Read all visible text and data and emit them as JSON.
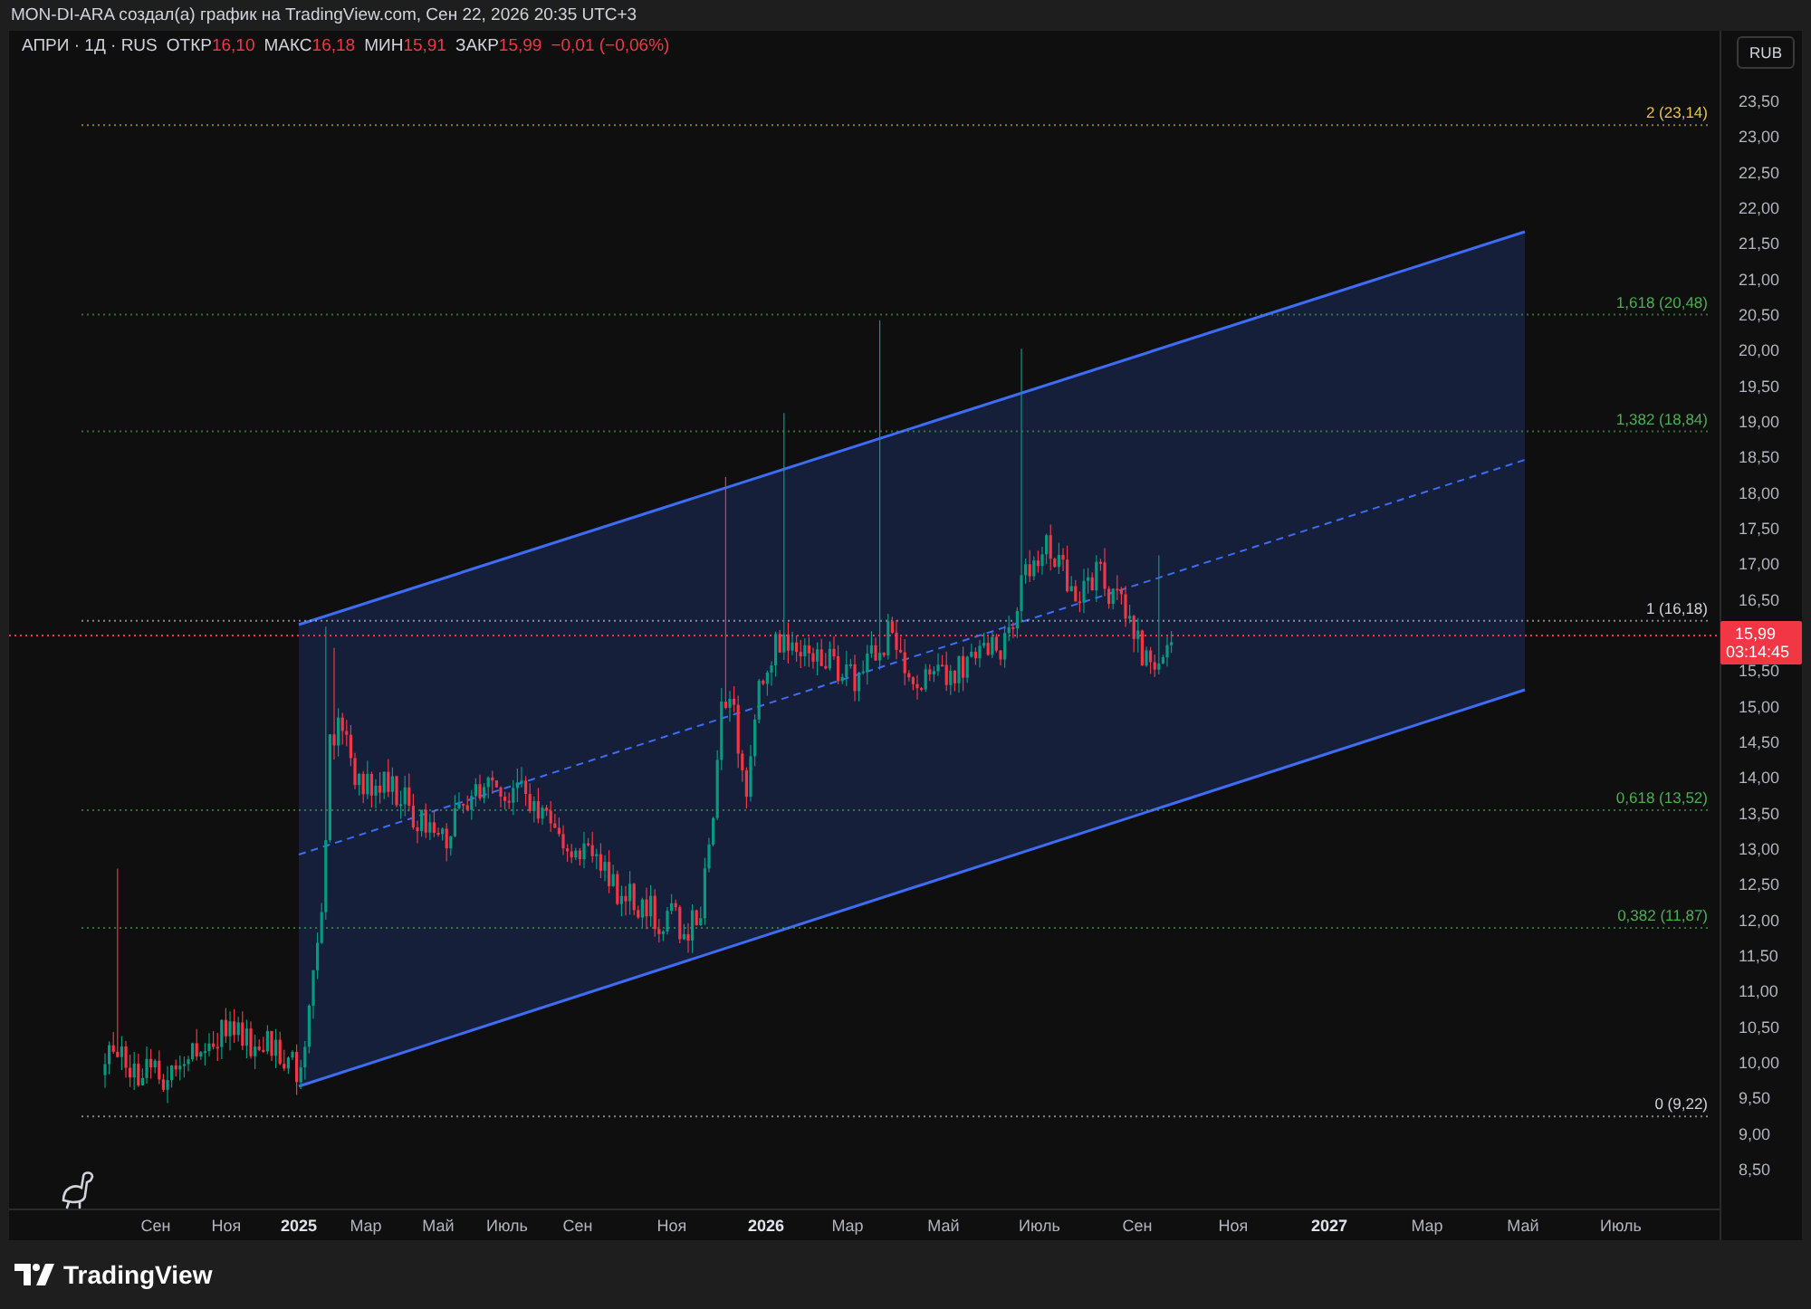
{
  "header": {
    "text": "MON-DI-ARA создал(а) график на TradingView.com, Сен 22, 2026 20:35 UTC+3"
  },
  "legend": {
    "symbol": "АПРИ · 1Д · RUS",
    "values": [
      {
        "label": "ОТКР",
        "value": "16,10"
      },
      {
        "label": "МАКС",
        "value": "16,18"
      },
      {
        "label": "МИН",
        "value": "15,91"
      },
      {
        "label": "ЗАКР",
        "value": "15,99"
      }
    ],
    "change": "−0,01 (−0,06%)"
  },
  "currency_button": {
    "label": "RUB"
  },
  "price_axis": {
    "ticks": [
      "23,50",
      "23,00",
      "22,50",
      "22,00",
      "21,50",
      "21,00",
      "20,50",
      "20,00",
      "19,50",
      "19,00",
      "18,50",
      "18,00",
      "17,50",
      "17,00",
      "16,50",
      "15,50",
      "15,00",
      "14,50",
      "14,00",
      "13,50",
      "13,00",
      "12,50",
      "12,00",
      "11,50",
      "11,00",
      "10,50",
      "10,00",
      "9,50",
      "9,00",
      "8,50"
    ]
  },
  "last_price": {
    "price": "15,99",
    "countdown": "03:14:45"
  },
  "fib_levels": [
    {
      "label": "2 (23,14)",
      "color": "#e8c547"
    },
    {
      "label": "1,618 (20,48)",
      "color": "#4caf50"
    },
    {
      "label": "1,382 (18,84)",
      "color": "#4caf50"
    },
    {
      "label": "1 (16,18)",
      "color": "#d1d4dc"
    },
    {
      "label": "0,618 (13,52)",
      "color": "#4caf50"
    },
    {
      "label": "0,382 (11,87)",
      "color": "#4caf50"
    },
    {
      "label": "0 (9,22)",
      "color": "#d1d4dc"
    }
  ],
  "time_axis": {
    "labels": [
      "Сен",
      "Ноя",
      "2025",
      "Мар",
      "Май",
      "Июль",
      "Сен",
      "Ноя",
      "2026",
      "Мар",
      "Май",
      "Июль",
      "Сен",
      "Ноя",
      "2027",
      "Мар",
      "Май",
      "Июль"
    ]
  },
  "footer": {
    "brand": "TradingView"
  }
}
